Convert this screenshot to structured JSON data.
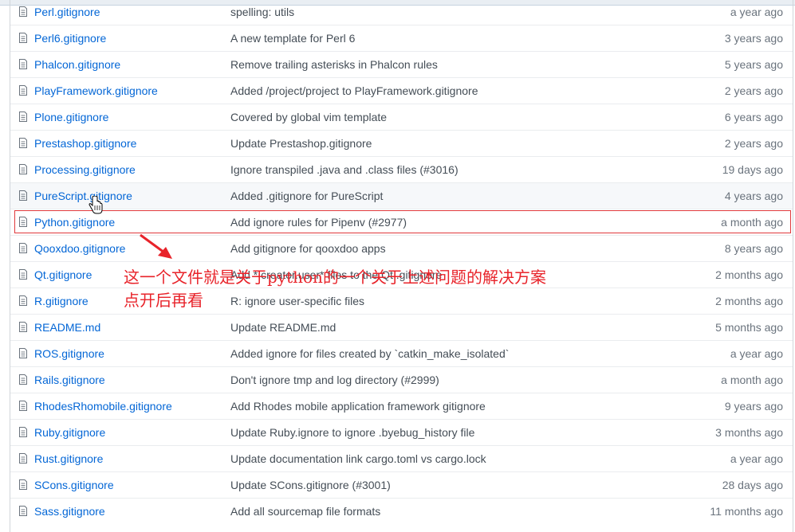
{
  "files": [
    {
      "name": "Perl.gitignore",
      "message": "spelling: utils",
      "age": "a year ago"
    },
    {
      "name": "Perl6.gitignore",
      "message": "A new template for Perl 6",
      "age": "3 years ago"
    },
    {
      "name": "Phalcon.gitignore",
      "message": "Remove trailing asterisks in Phalcon rules",
      "age": "5 years ago"
    },
    {
      "name": "PlayFramework.gitignore",
      "message": "Added /project/project to PlayFramework.gitignore",
      "age": "2 years ago"
    },
    {
      "name": "Plone.gitignore",
      "message": "Covered by global vim template",
      "age": "6 years ago"
    },
    {
      "name": "Prestashop.gitignore",
      "message": "Update Prestashop.gitignore",
      "age": "2 years ago"
    },
    {
      "name": "Processing.gitignore",
      "message": "Ignore transpiled .java and .class files (#3016)",
      "age": "19 days ago"
    },
    {
      "name": "PureScript.gitignore",
      "message": "Added .gitignore for PureScript",
      "age": "4 years ago"
    },
    {
      "name": "Python.gitignore",
      "message": "Add ignore rules for Pipenv (#2977)",
      "age": "a month ago"
    },
    {
      "name": "Qooxdoo.gitignore",
      "message": "Add gitignore for qooxdoo apps",
      "age": "8 years ago"
    },
    {
      "name": "Qt.gitignore",
      "message": "Add *.creator.user* files to the Qt .gitignore",
      "age": "2 months ago"
    },
    {
      "name": "R.gitignore",
      "message": "R: ignore user-specific files",
      "age": "2 months ago"
    },
    {
      "name": "README.md",
      "message": "Update README.md",
      "age": "5 months ago"
    },
    {
      "name": "ROS.gitignore",
      "message": "Added ignore for files created by `catkin_make_isolated`",
      "age": "a year ago"
    },
    {
      "name": "Rails.gitignore",
      "message": "Don't ignore tmp and log directory (#2999)",
      "age": "a month ago"
    },
    {
      "name": "RhodesRhomobile.gitignore",
      "message": "Add Rhodes mobile application framework gitignore",
      "age": "9 years ago"
    },
    {
      "name": "Ruby.gitignore",
      "message": "Update Ruby.ignore to ignore .byebug_history file",
      "age": "3 months ago"
    },
    {
      "name": "Rust.gitignore",
      "message": "Update documentation link cargo.toml vs cargo.lock",
      "age": "a year ago"
    },
    {
      "name": "SCons.gitignore",
      "message": "Update SCons.gitignore (#3001)",
      "age": "28 days ago"
    },
    {
      "name": "Sass.gitignore",
      "message": "Add all sourcemap file formats",
      "age": "11 months ago"
    }
  ],
  "annotation": {
    "line1": "这一个文件就是关于python的一个关于上述问题的解决方案",
    "line2": "点开后再看",
    "color": "#e8232a"
  },
  "colors": {
    "link": "#0366d6",
    "muted": "#6a737d",
    "hover_row": "#f6f8fa",
    "highlight_box": "#e0393c"
  },
  "icons": {
    "file": "file-icon",
    "cursor": "hand-pointer-icon",
    "arrow": "red-arrow-icon"
  }
}
